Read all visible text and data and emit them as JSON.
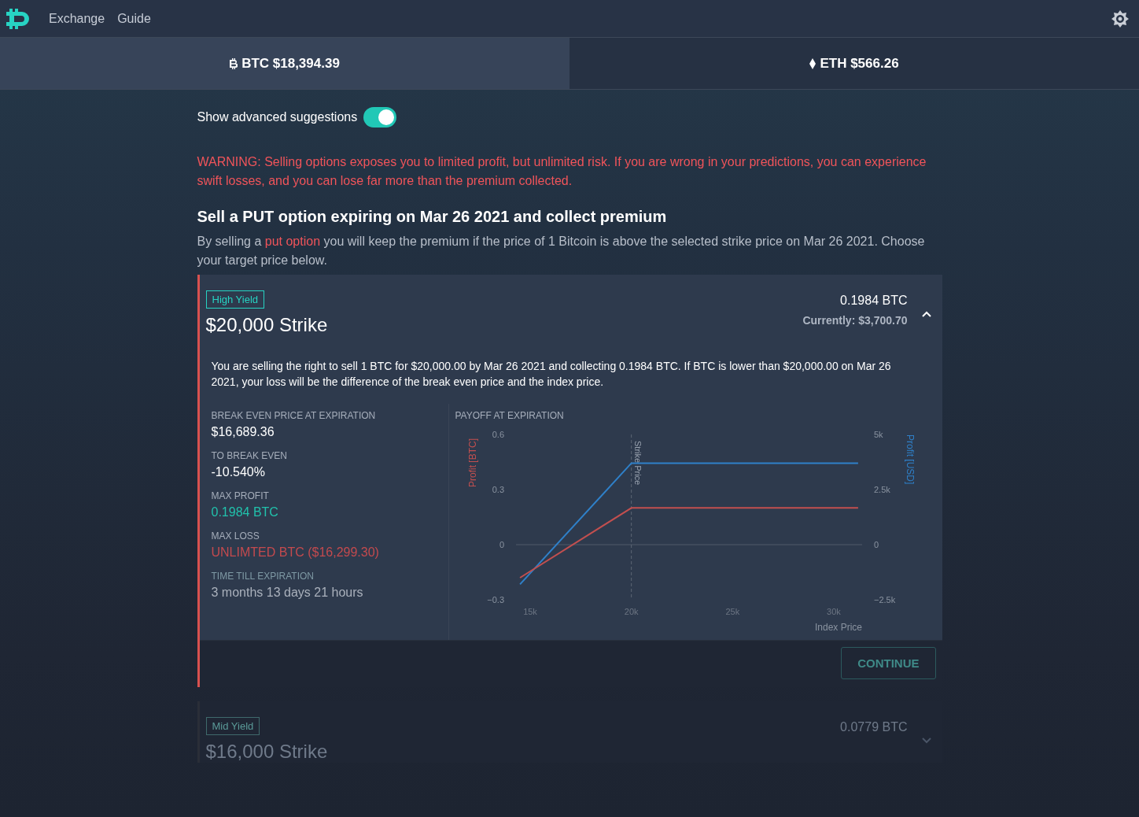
{
  "nav": {
    "links": [
      {
        "label": "Exchange"
      },
      {
        "label": "Guide"
      }
    ]
  },
  "tabs": [
    {
      "label": "BTC $18,394.39",
      "kind": "btc",
      "selected": true
    },
    {
      "label": "ETH $566.26",
      "kind": "eth",
      "selected": false
    }
  ],
  "advanced_toggle": {
    "label": "Show advanced suggestions",
    "on": true
  },
  "warning": "WARNING: Selling options exposes you to limited profit, but unlimited risk. If you are wrong in your predictions, you can experience swift losses, and you can lose far more than the premium collected.",
  "heading": "Sell a PUT option expiring on Mar 26 2021 and collect premium",
  "description": {
    "before": "By selling a ",
    "link": "put option",
    "after": " you will keep the premium if the price of 1 Bitcoin is above the selected strike price on Mar 26 2021. Choose your target price below."
  },
  "options": [
    {
      "badge": "High Yield",
      "strike": "$20,000 Strike",
      "premium": "0.1984 BTC",
      "current": "Currently: $3,700.70",
      "expanded": true,
      "explanation": "You are selling the right to sell 1 BTC for $20,000.00 by Mar 26 2021 and collecting 0.1984 BTC. If BTC is lower than $20,000.00 on Mar 26 2021, your loss will be the difference of the break even price and the index price.",
      "stats": [
        {
          "label": "BREAK EVEN PRICE AT EXPIRATION",
          "value": "$16,689.36",
          "kind": "plain"
        },
        {
          "label": "TO BREAK EVEN",
          "value": "-10.540%",
          "kind": "plain"
        },
        {
          "label": "MAX PROFIT",
          "value": "0.1984 BTC",
          "kind": "profit"
        },
        {
          "label": "MAX LOSS",
          "value": "UNLIMTED BTC ($16,299.30)",
          "kind": "loss"
        },
        {
          "label": "TIME TILL EXPIRATION",
          "value": "3 months 13 days 21 hours",
          "kind": "muted"
        }
      ],
      "chart_data": {
        "type": "line",
        "title": "PAYOFF AT EXPIRATION",
        "xlabel": "Index Price",
        "x": [
          14500,
          20000,
          31200
        ],
        "series": [
          {
            "name": "Profit [USD]",
            "color": "#2f80c9",
            "axis": "y2",
            "values": [
              -1800,
              3700,
              3700
            ]
          },
          {
            "name": "Profit [BTC]",
            "color": "#c24f4f",
            "axis": "y",
            "values": [
              -0.18,
              0.2,
              0.2
            ]
          }
        ],
        "xlim": [
          14300,
          31400
        ],
        "ylim": [
          -0.3,
          0.6
        ],
        "y2lim": [
          -2500,
          5000
        ],
        "xticks": [
          {
            "value": 15000,
            "label": "15k"
          },
          {
            "value": 20000,
            "label": "20k"
          },
          {
            "value": 25000,
            "label": "25k"
          },
          {
            "value": 30000,
            "label": "30k"
          }
        ],
        "yticks": [
          {
            "value": -0.3,
            "label": "−0.3"
          },
          {
            "value": 0,
            "label": "0"
          },
          {
            "value": 0.3,
            "label": "0.3"
          },
          {
            "value": 0.6,
            "label": "0.6"
          }
        ],
        "y2ticks": [
          {
            "value": -2500,
            "label": "−2.5k"
          },
          {
            "value": 0,
            "label": "0"
          },
          {
            "value": 2500,
            "label": "2.5k"
          },
          {
            "value": 5000,
            "label": "5k"
          }
        ],
        "ref_lines": [
          {
            "axis": "x",
            "value": 20000,
            "label": "Strike Price"
          }
        ]
      },
      "button": "CONTINUE"
    },
    {
      "badge": "Mid Yield",
      "strike": "$16,000 Strike",
      "premium": "0.0779 BTC",
      "expanded": false
    }
  ]
}
